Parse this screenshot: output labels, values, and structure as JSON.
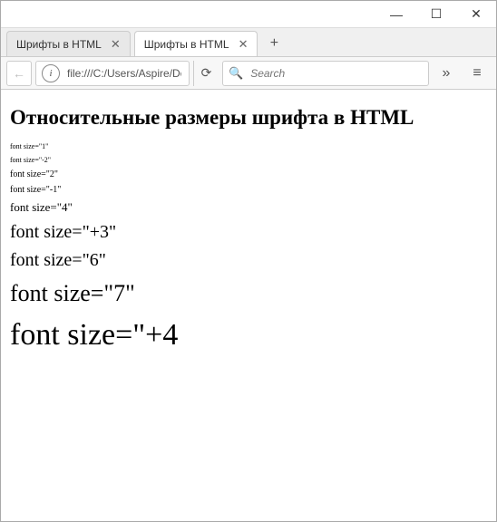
{
  "window": {
    "minimize": "—",
    "maximize": "☐",
    "close": "✕"
  },
  "tabs": [
    {
      "label": "Шрифты в HTML",
      "active": false
    },
    {
      "label": "Шрифты в HTML",
      "active": true
    }
  ],
  "newTab": "+",
  "toolbar": {
    "back": "←",
    "info": "i",
    "url": "file:///C:/Users/Aspire/Desk",
    "reload": "⟳",
    "searchPlaceholder": "Search",
    "overflow": "»",
    "menu": "≡"
  },
  "page": {
    "heading": "Относительные размеры шрифта в HTML",
    "lines": [
      {
        "text": "font size=\"1\"",
        "cls": "fs1"
      },
      {
        "text": "font size=\"-2\"",
        "cls": "fs1"
      },
      {
        "text": "font size=\"2\"",
        "cls": "fs2"
      },
      {
        "text": "font size=\"-1\"",
        "cls": "fs2"
      },
      {
        "text": "font size=\"4\"",
        "cls": "fs3"
      },
      {
        "text": "font size=\"+3\"",
        "cls": "fs5"
      },
      {
        "text": "font size=\"6\"",
        "cls": "fs5"
      },
      {
        "text": "font size=\"7\"",
        "cls": "fs6"
      },
      {
        "text": "font size=\"+4",
        "cls": "fs7"
      }
    ]
  }
}
